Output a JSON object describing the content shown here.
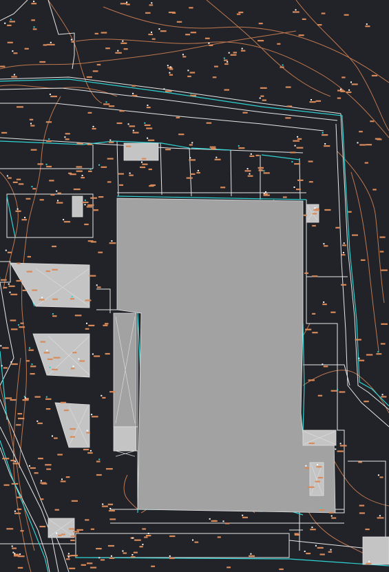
{
  "drawing": {
    "background": "#212328",
    "colors": {
      "boundary_line": "#e8e8e8",
      "contour_line": "#c07850",
      "utility_line": "#2fd4d4",
      "building_fill": "#a2a2a2",
      "shed_fill": "#c4c4c4",
      "elevation_label": "#d98a5a",
      "point_marker": "#ffffff"
    },
    "layers": [
      "parcel-boundaries",
      "contours",
      "utility-lines",
      "buildings",
      "elevation-labels",
      "survey-points"
    ]
  }
}
